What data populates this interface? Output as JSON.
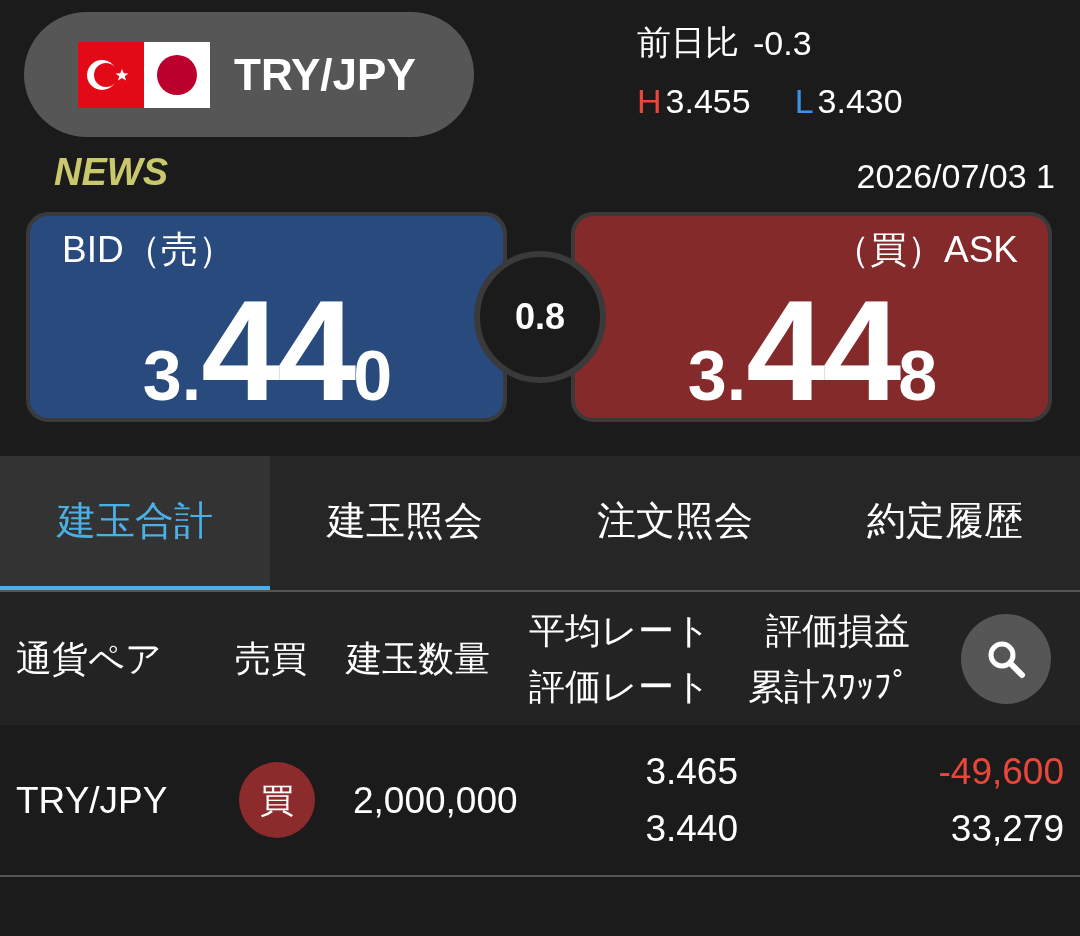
{
  "pair_selector": {
    "label": "TRY/JPY"
  },
  "summary": {
    "change_label": "前日比",
    "change": "-0.3",
    "high_label": "H",
    "high": "3.455",
    "low_label": "L",
    "low": "3.430"
  },
  "news": "NEWS",
  "timestamp": "2026/07/03 1",
  "quotes": [
    {
      "kind": "bid",
      "label": "BID（売）",
      "lead": "3.",
      "pips": "44",
      "tail": "0"
    },
    {
      "kind": "ask",
      "label": "（買）ASK",
      "lead": "3.",
      "pips": "44",
      "tail": "8"
    }
  ],
  "spread": "0.8",
  "tabs": [
    {
      "label": "建玉合計",
      "selected": true
    },
    {
      "label": "建玉照会",
      "selected": false
    },
    {
      "label": "注文照会",
      "selected": false
    },
    {
      "label": "約定履歴",
      "selected": false
    }
  ],
  "table": {
    "columns": [
      {
        "lines": [
          "通貨ペア"
        ]
      },
      {
        "lines": [
          "売買"
        ]
      },
      {
        "lines": [
          "建玉数量"
        ]
      },
      {
        "lines": [
          "平均レート",
          "評価レート"
        ]
      },
      {
        "lines": [
          "評価損益",
          "累計ｽﾜｯﾌﾟ"
        ]
      }
    ],
    "rows": [
      {
        "kind": "buy",
        "pair": "TRY/JPY",
        "side": "買",
        "quantity": "2,000,000",
        "average_rate": "3.465",
        "valuation_rate": "3.440",
        "profit_loss": "-49,600",
        "loss": true,
        "swap": "33,279"
      }
    ]
  }
}
